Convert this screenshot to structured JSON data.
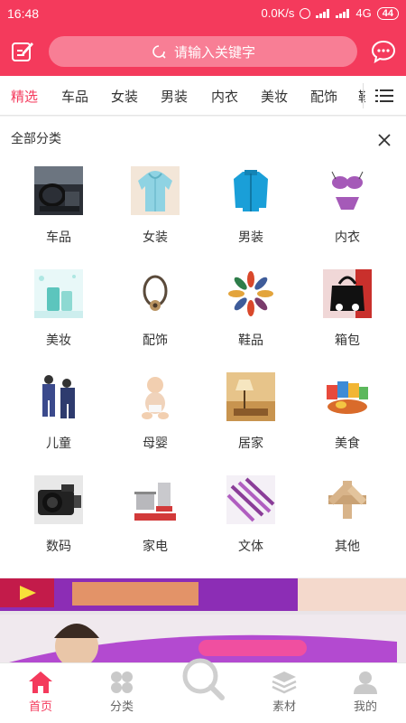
{
  "status_bar": {
    "time": "16:48",
    "speed": "0.0K/s",
    "network": "4G",
    "battery": "44"
  },
  "header": {
    "search_placeholder": "请输入关键字"
  },
  "tabs": [
    {
      "label": "精选",
      "active": true
    },
    {
      "label": "车品"
    },
    {
      "label": "女装"
    },
    {
      "label": "男装"
    },
    {
      "label": "内衣"
    },
    {
      "label": "美妆"
    },
    {
      "label": "配饰"
    },
    {
      "label": "鞋"
    }
  ],
  "panel": {
    "title": "全部分类",
    "categories": [
      {
        "label": "车品",
        "icon": "car-interior-image"
      },
      {
        "label": "女装",
        "icon": "hoodie-image"
      },
      {
        "label": "男装",
        "icon": "jacket-image"
      },
      {
        "label": "内衣",
        "icon": "lingerie-image"
      },
      {
        "label": "美妆",
        "icon": "cosmetics-image"
      },
      {
        "label": "配饰",
        "icon": "bracelet-image"
      },
      {
        "label": "鞋品",
        "icon": "shoes-image"
      },
      {
        "label": "箱包",
        "icon": "handbag-image"
      },
      {
        "label": "儿童",
        "icon": "kids-clothing-image"
      },
      {
        "label": "母婴",
        "icon": "baby-image"
      },
      {
        "label": "居家",
        "icon": "lamp-image"
      },
      {
        "label": "美食",
        "icon": "snacks-image"
      },
      {
        "label": "数码",
        "icon": "camera-image"
      },
      {
        "label": "家电",
        "icon": "cookware-image"
      },
      {
        "label": "文体",
        "icon": "pens-image"
      },
      {
        "label": "其他",
        "icon": "wooden-puzzle-image"
      }
    ]
  },
  "bottom_nav": [
    {
      "label": "首页",
      "icon": "home-icon",
      "active": true
    },
    {
      "label": "分类",
      "icon": "category-icon"
    },
    {
      "label": "",
      "icon": "search-icon"
    },
    {
      "label": "素材",
      "icon": "layers-icon"
    },
    {
      "label": "我的",
      "icon": "user-icon"
    }
  ],
  "colors": {
    "accent": "#f43a5c",
    "text": "#333333",
    "muted": "#666666"
  }
}
